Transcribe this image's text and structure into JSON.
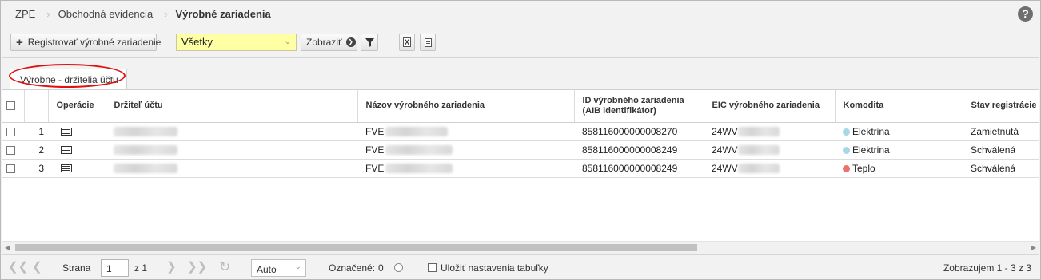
{
  "breadcrumb": {
    "items": [
      "ZPE",
      "Obchodná evidencia",
      "Výrobné zariadenia"
    ]
  },
  "help": {
    "label": "?"
  },
  "toolbar": {
    "register_label": "Registrovať výrobné zariadenie",
    "filter_selected": "Všetky",
    "show_label": "Zobraziť",
    "xls_label": "X"
  },
  "tabs": [
    {
      "label": "Výrobne - držitelia účtu",
      "highlighted": true
    }
  ],
  "grid": {
    "columns": [
      "",
      "",
      "Operácie",
      "Držiteľ účtu",
      "Názov výrobného zariadenia",
      "ID výrobného zariadenia (AIB identifikátor)",
      "EIC výrobného zariadenia",
      "Komodita",
      "Stav registrácie"
    ],
    "rows": [
      {
        "num": "1",
        "holder": "",
        "name_prefix": "FVE",
        "aib_id": "858116000000008270",
        "eic_prefix": "24WV",
        "commodity": "Elektrina",
        "commodity_color": "#a8d8e8",
        "status": "Zamietnutá"
      },
      {
        "num": "2",
        "holder": "",
        "name_prefix": "FVE",
        "aib_id": "858116000000008249",
        "eic_prefix": "24WV",
        "commodity": "Elektrina",
        "commodity_color": "#a8d8e8",
        "status": "Schválená"
      },
      {
        "num": "3",
        "holder": "",
        "name_prefix": "FVE",
        "aib_id": "858116000000008249",
        "eic_prefix": "24WV",
        "commodity": "Teplo",
        "commodity_color": "#f07070",
        "status": "Schválená"
      }
    ]
  },
  "pager": {
    "page_label": "Strana",
    "page_value": "1",
    "of_label": "z 1",
    "page_size": "Auto",
    "selected_label": "Označené:",
    "selected_count": "0",
    "save_settings_label": "Uložiť nastavenia tabuľky",
    "summary": "Zobrazujem 1 - 3 z 3"
  }
}
